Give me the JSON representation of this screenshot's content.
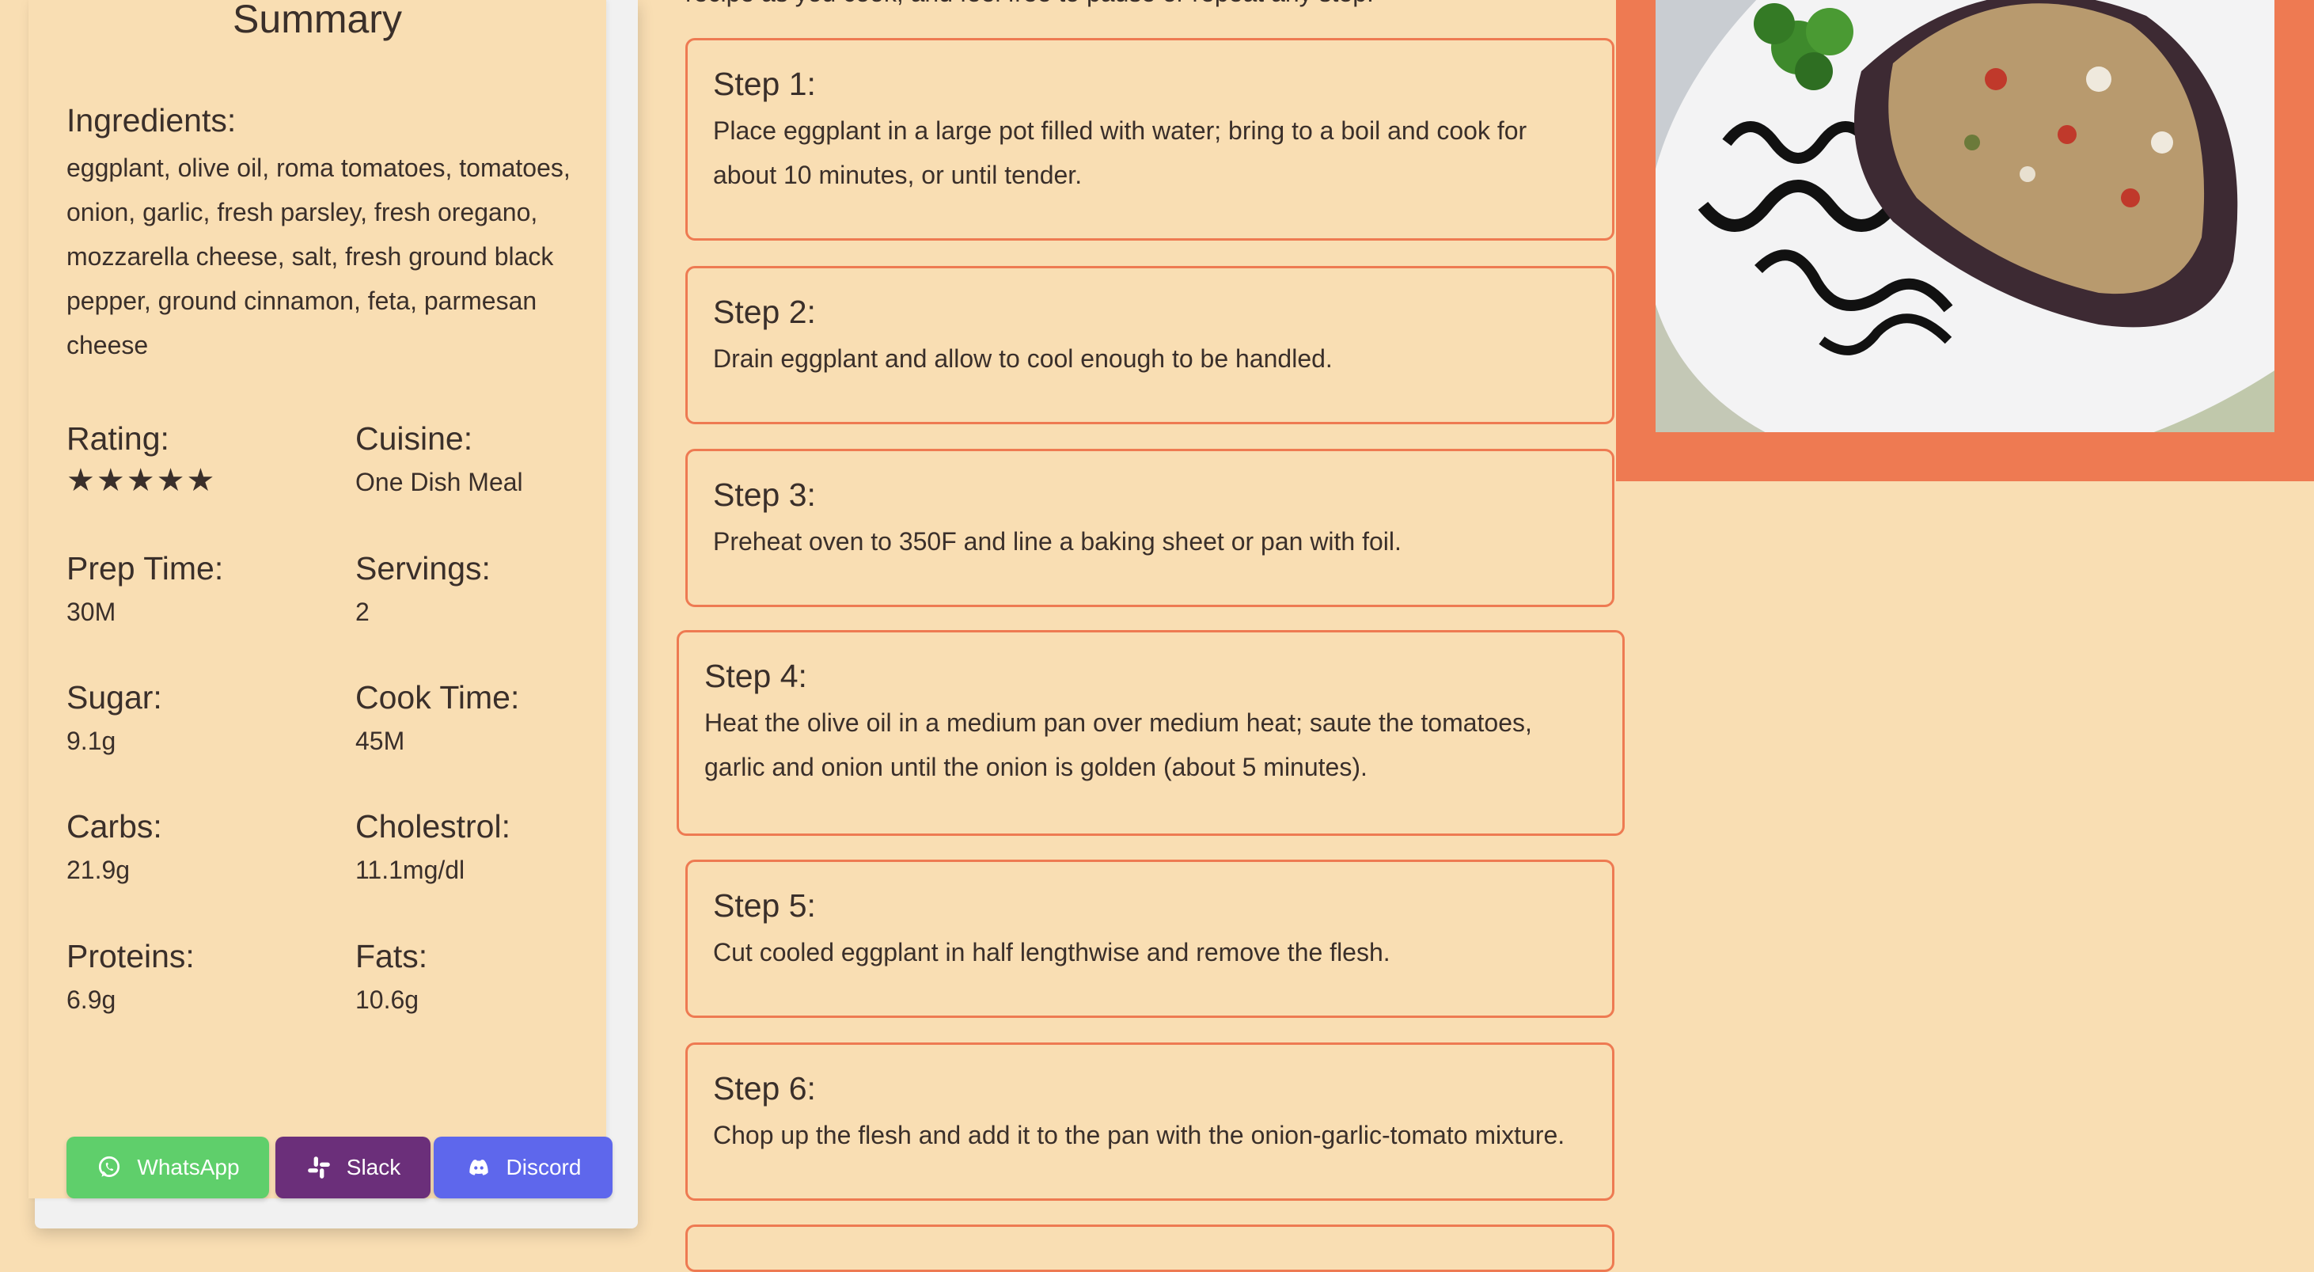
{
  "summary": {
    "title": "Summary",
    "ingredients_label": "Ingredients:",
    "ingredients": "eggplant, olive oil, roma tomatoes, tomatoes, onion, garlic, fresh parsley, fresh oregano, mozzarella cheese, salt, fresh ground black pepper, ground cinnamon, feta, parmesan cheese",
    "rating_label": "Rating:",
    "rating": 5,
    "rating_max": 5,
    "rating_stars": "★★★★★",
    "cuisine_label": "Cuisine:",
    "cuisine": "One Dish Meal",
    "prep_label": "Prep Time:",
    "prep": "30M",
    "servings_label": "Servings:",
    "servings": "2",
    "sugar_label": "Sugar:",
    "sugar": "9.1g",
    "cook_label": "Cook Time:",
    "cook": "45M",
    "carbs_label": "Carbs:",
    "carbs": "21.9g",
    "cholestrol_label": "Cholestrol:",
    "cholestrol": "11.1mg/dl",
    "proteins_label": "Proteins:",
    "proteins": "6.9g",
    "fats_label": "Fats:",
    "fats": "10.6g"
  },
  "share": {
    "whatsapp": "WhatsApp",
    "slack": "Slack",
    "discord": "Discord"
  },
  "intro_text": "recipe as you cook, and feel free to pause or repeat any step.",
  "steps": [
    {
      "title": "Step 1:",
      "text": "Place eggplant in a large pot filled with water; bring to a boil and cook for about 10 minutes, or until tender."
    },
    {
      "title": "Step 2:",
      "text": "Drain eggplant and allow to cool enough to be handled."
    },
    {
      "title": "Step 3:",
      "text": "Preheat oven to 350F and line a baking sheet or pan with foil."
    },
    {
      "title": "Step 4:",
      "text": "Heat the olive oil in a medium pan over medium heat; saute the tomatoes, garlic and onion until the onion is golden (about 5 minutes)."
    },
    {
      "title": "Step 5:",
      "text": "Cut cooled eggplant in half lengthwise and remove the flesh."
    },
    {
      "title": "Step 6:",
      "text": "Chop up the flesh and add it to the pan with the onion-garlic-tomato mixture."
    }
  ],
  "colors": {
    "background": "#f9deb3",
    "accent": "#ee7a52",
    "whatsapp": "#5fcf6b",
    "slack": "#6b2f7a",
    "discord": "#5e67ec"
  },
  "icons": [
    "whatsapp-icon",
    "slack-icon",
    "discord-icon"
  ]
}
